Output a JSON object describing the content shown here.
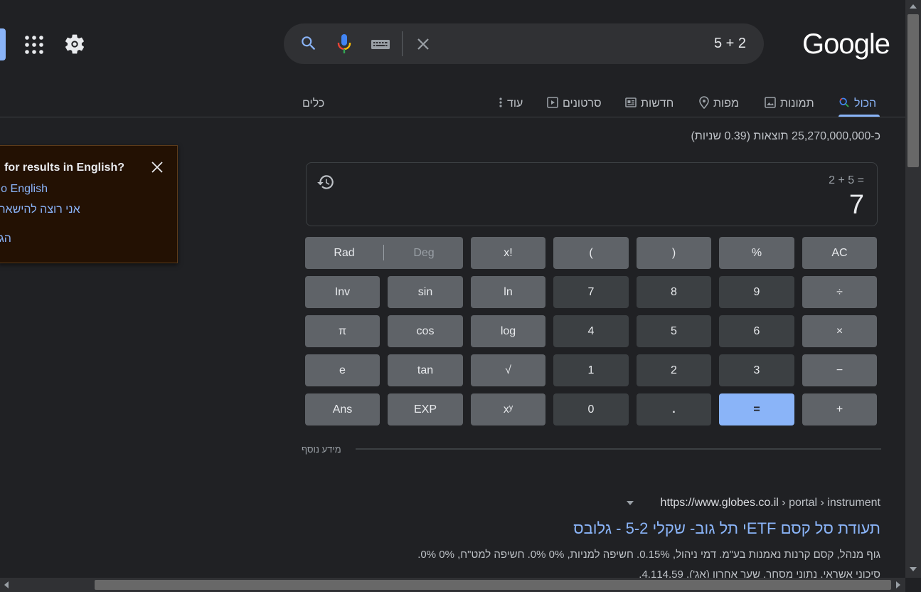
{
  "search": {
    "query": "5 + 2",
    "logo_text": "Google"
  },
  "icons": {
    "apps": "apps-grid-icon",
    "settings": "gear-icon",
    "search": "search-icon",
    "mic": "mic-icon",
    "keyboard": "keyboard-icon",
    "clear": "close-icon",
    "history": "history-icon"
  },
  "tabs": {
    "all": "הכול",
    "images": "תמונות",
    "maps": "מפות",
    "news": "חדשות",
    "videos": "סרטונים",
    "more": "עוד",
    "tools": "כלים"
  },
  "results_stats": "כ-25,270,000,000 תוצאות (0.39 שניות)",
  "language_popup": {
    "title": "for results in English?",
    "link_english": "o English",
    "link_stay": "אני רוצה להישאר",
    "link_settings": "הג"
  },
  "calculator": {
    "expression": "2 + 5 =",
    "result": "7",
    "rad": "Rad",
    "deg": "Deg",
    "keys": {
      "fact": "x!",
      "lparen": "(",
      "rparen": ")",
      "percent": "%",
      "ac": "AC",
      "inv": "Inv",
      "sin": "sin",
      "ln": "ln",
      "k7": "7",
      "k8": "8",
      "k9": "9",
      "div": "÷",
      "pi": "π",
      "cos": "cos",
      "log": "log",
      "k4": "4",
      "k5": "5",
      "k6": "6",
      "mul": "×",
      "e": "e",
      "tan": "tan",
      "sqrt": "√",
      "k1": "1",
      "k2": "2",
      "k3": "3",
      "sub": "−",
      "ans": "Ans",
      "exp": "EXP",
      "pow": "xʸ",
      "k0": "0",
      "dot": ".",
      "eq": "=",
      "add": "+"
    }
  },
  "more_info": "מידע נוסף",
  "result": {
    "site": "https://www.globes.co.il",
    "path": " › portal › instrument",
    "title": "תעודת סל קסם ETFי תל גוב- שקלי 5-2 - גלובס",
    "snippet_line1": "גוף מנהל, קסם קרנות נאמנות בע\"מ. דמי ניהול, 0.15%. חשיפה למניות, 0% 0%. חשיפה למט\"ח, 0% 0%.",
    "snippet_line2": "סיכוני אשראי. נתוני מסחר. שער אחרון (אג'), 4,114.59."
  },
  "colors": {
    "background": "#202124",
    "accent": "#8ab4f8",
    "popup_background": "#231103"
  }
}
